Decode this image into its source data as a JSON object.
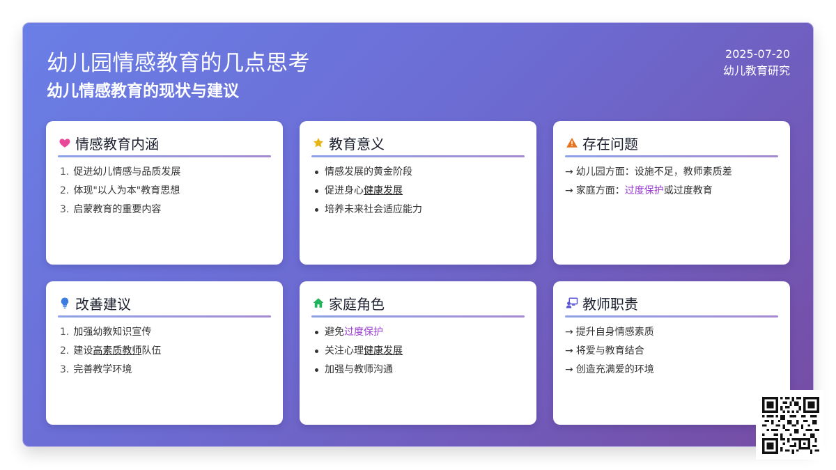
{
  "header": {
    "title": "幼儿园情感教育的几点思考",
    "subtitle": "幼儿情感教育的现状与建议",
    "date": "2025-07-20",
    "org": "幼儿教育研究"
  },
  "cards": [
    {
      "title": "情感教育内涵",
      "icon": "heart-icon",
      "icon_color": "#e8479a",
      "list": "ordered",
      "items": [
        {
          "num": "1.",
          "text": "促进幼儿情感与品质发展"
        },
        {
          "num": "2.",
          "text": "体现\"以人为本\"教育思想"
        },
        {
          "num": "3.",
          "text": "启蒙教育的重要内容"
        }
      ]
    },
    {
      "title": "教育意义",
      "icon": "star-icon",
      "icon_color": "#e6b40f",
      "list": "bullet",
      "items": [
        {
          "text": "情感发展的黄金阶段"
        },
        {
          "pre": "促进身心",
          "hl": "健康发展"
        },
        {
          "text": "培养未来社会适应能力"
        }
      ]
    },
    {
      "title": "存在问题",
      "icon": "warning-icon",
      "icon_color": "#e8731e",
      "list": "arrow",
      "items": [
        {
          "text": "幼儿园方面：设施不足，教师素质差"
        },
        {
          "pre": "家庭方面：",
          "hl": "过度保护",
          "post": "或过度教育"
        }
      ]
    },
    {
      "title": "改善建议",
      "icon": "lightbulb-icon",
      "icon_color": "#3b7de0",
      "list": "ordered",
      "items": [
        {
          "num": "1.",
          "text": "加强幼教知识宣传"
        },
        {
          "num": "2.",
          "pre": "建设",
          "hl": "高素质教师",
          "post": "队伍"
        },
        {
          "num": "3.",
          "text": "完善教学环境"
        }
      ]
    },
    {
      "title": "家庭角色",
      "icon": "home-icon",
      "icon_color": "#22b35c",
      "list": "bullet",
      "items": [
        {
          "pre": "避免",
          "hl": "过度保护"
        },
        {
          "pre": "关注心理",
          "hl": "健康发展"
        },
        {
          "text": "加强与教师沟通"
        }
      ]
    },
    {
      "title": "教师职责",
      "icon": "teacher-icon",
      "icon_color": "#5a55d8",
      "list": "arrow",
      "items": [
        {
          "text": "提升自身情感素质"
        },
        {
          "text": "将爱与教育结合"
        },
        {
          "text": "创造充满爱的环境"
        }
      ]
    }
  ],
  "markers": {
    "arrow": "→"
  }
}
